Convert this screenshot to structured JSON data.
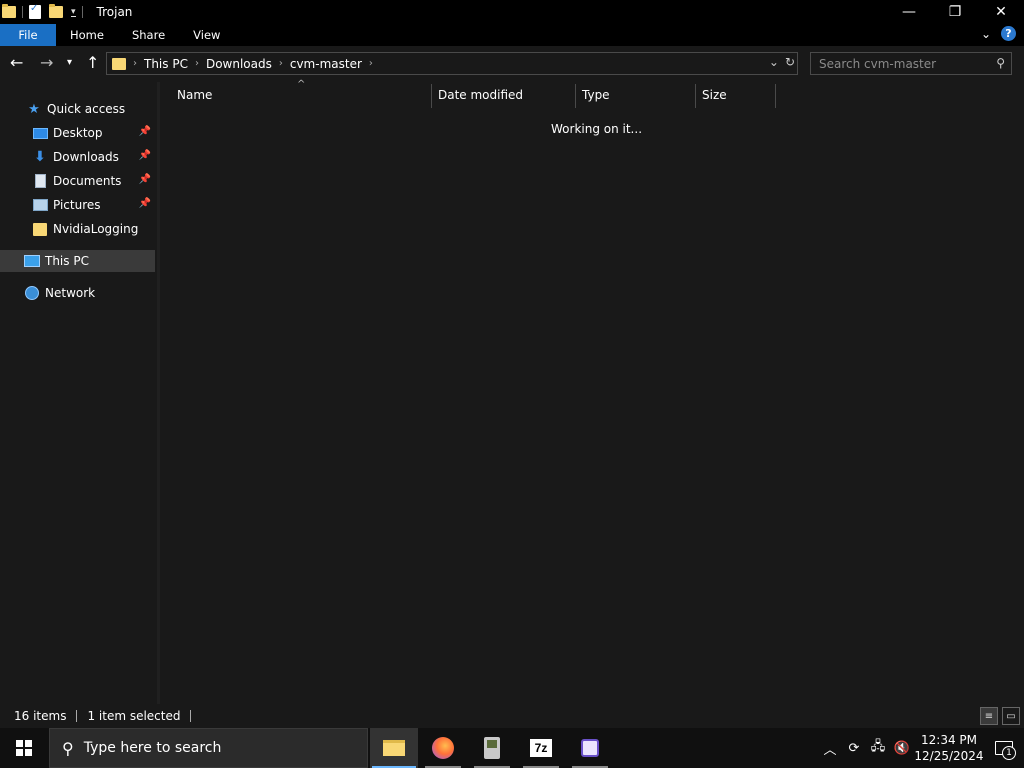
{
  "window": {
    "title": "Trojan",
    "controls": {
      "minimize": "—",
      "restore": "❐",
      "close": "✕"
    }
  },
  "ribbon": {
    "tabs": [
      "File",
      "Home",
      "Share",
      "View"
    ]
  },
  "address": {
    "crumbs": [
      "This PC",
      "Downloads",
      "cvm-master"
    ]
  },
  "search": {
    "placeholder": "Search cvm-master"
  },
  "nav_pane": {
    "quick_access": "Quick access",
    "items": [
      {
        "label": "Desktop",
        "icon": "desktop-icon",
        "pinned": true
      },
      {
        "label": "Downloads",
        "icon": "downloads-icon",
        "pinned": true
      },
      {
        "label": "Documents",
        "icon": "documents-icon",
        "pinned": true
      },
      {
        "label": "Pictures",
        "icon": "pictures-icon",
        "pinned": true
      },
      {
        "label": "NvidiaLogging",
        "icon": "folder-icon",
        "pinned": false
      }
    ],
    "this_pc": "This PC",
    "network": "Network"
  },
  "columns": [
    "Name",
    "Date modified",
    "Type",
    "Size"
  ],
  "content": {
    "status_message": "Working on it..."
  },
  "status_bar": {
    "item_count": "16 items",
    "selection": "1 item selected"
  },
  "taskbar": {
    "search_placeholder": "Type here to search",
    "apps": [
      "file-explorer",
      "firefox",
      "gameboy-emulator",
      "7zip",
      "calculator-app"
    ],
    "clock_time": "12:34 PM",
    "clock_date": "12/25/2024",
    "notification_count": "1"
  }
}
